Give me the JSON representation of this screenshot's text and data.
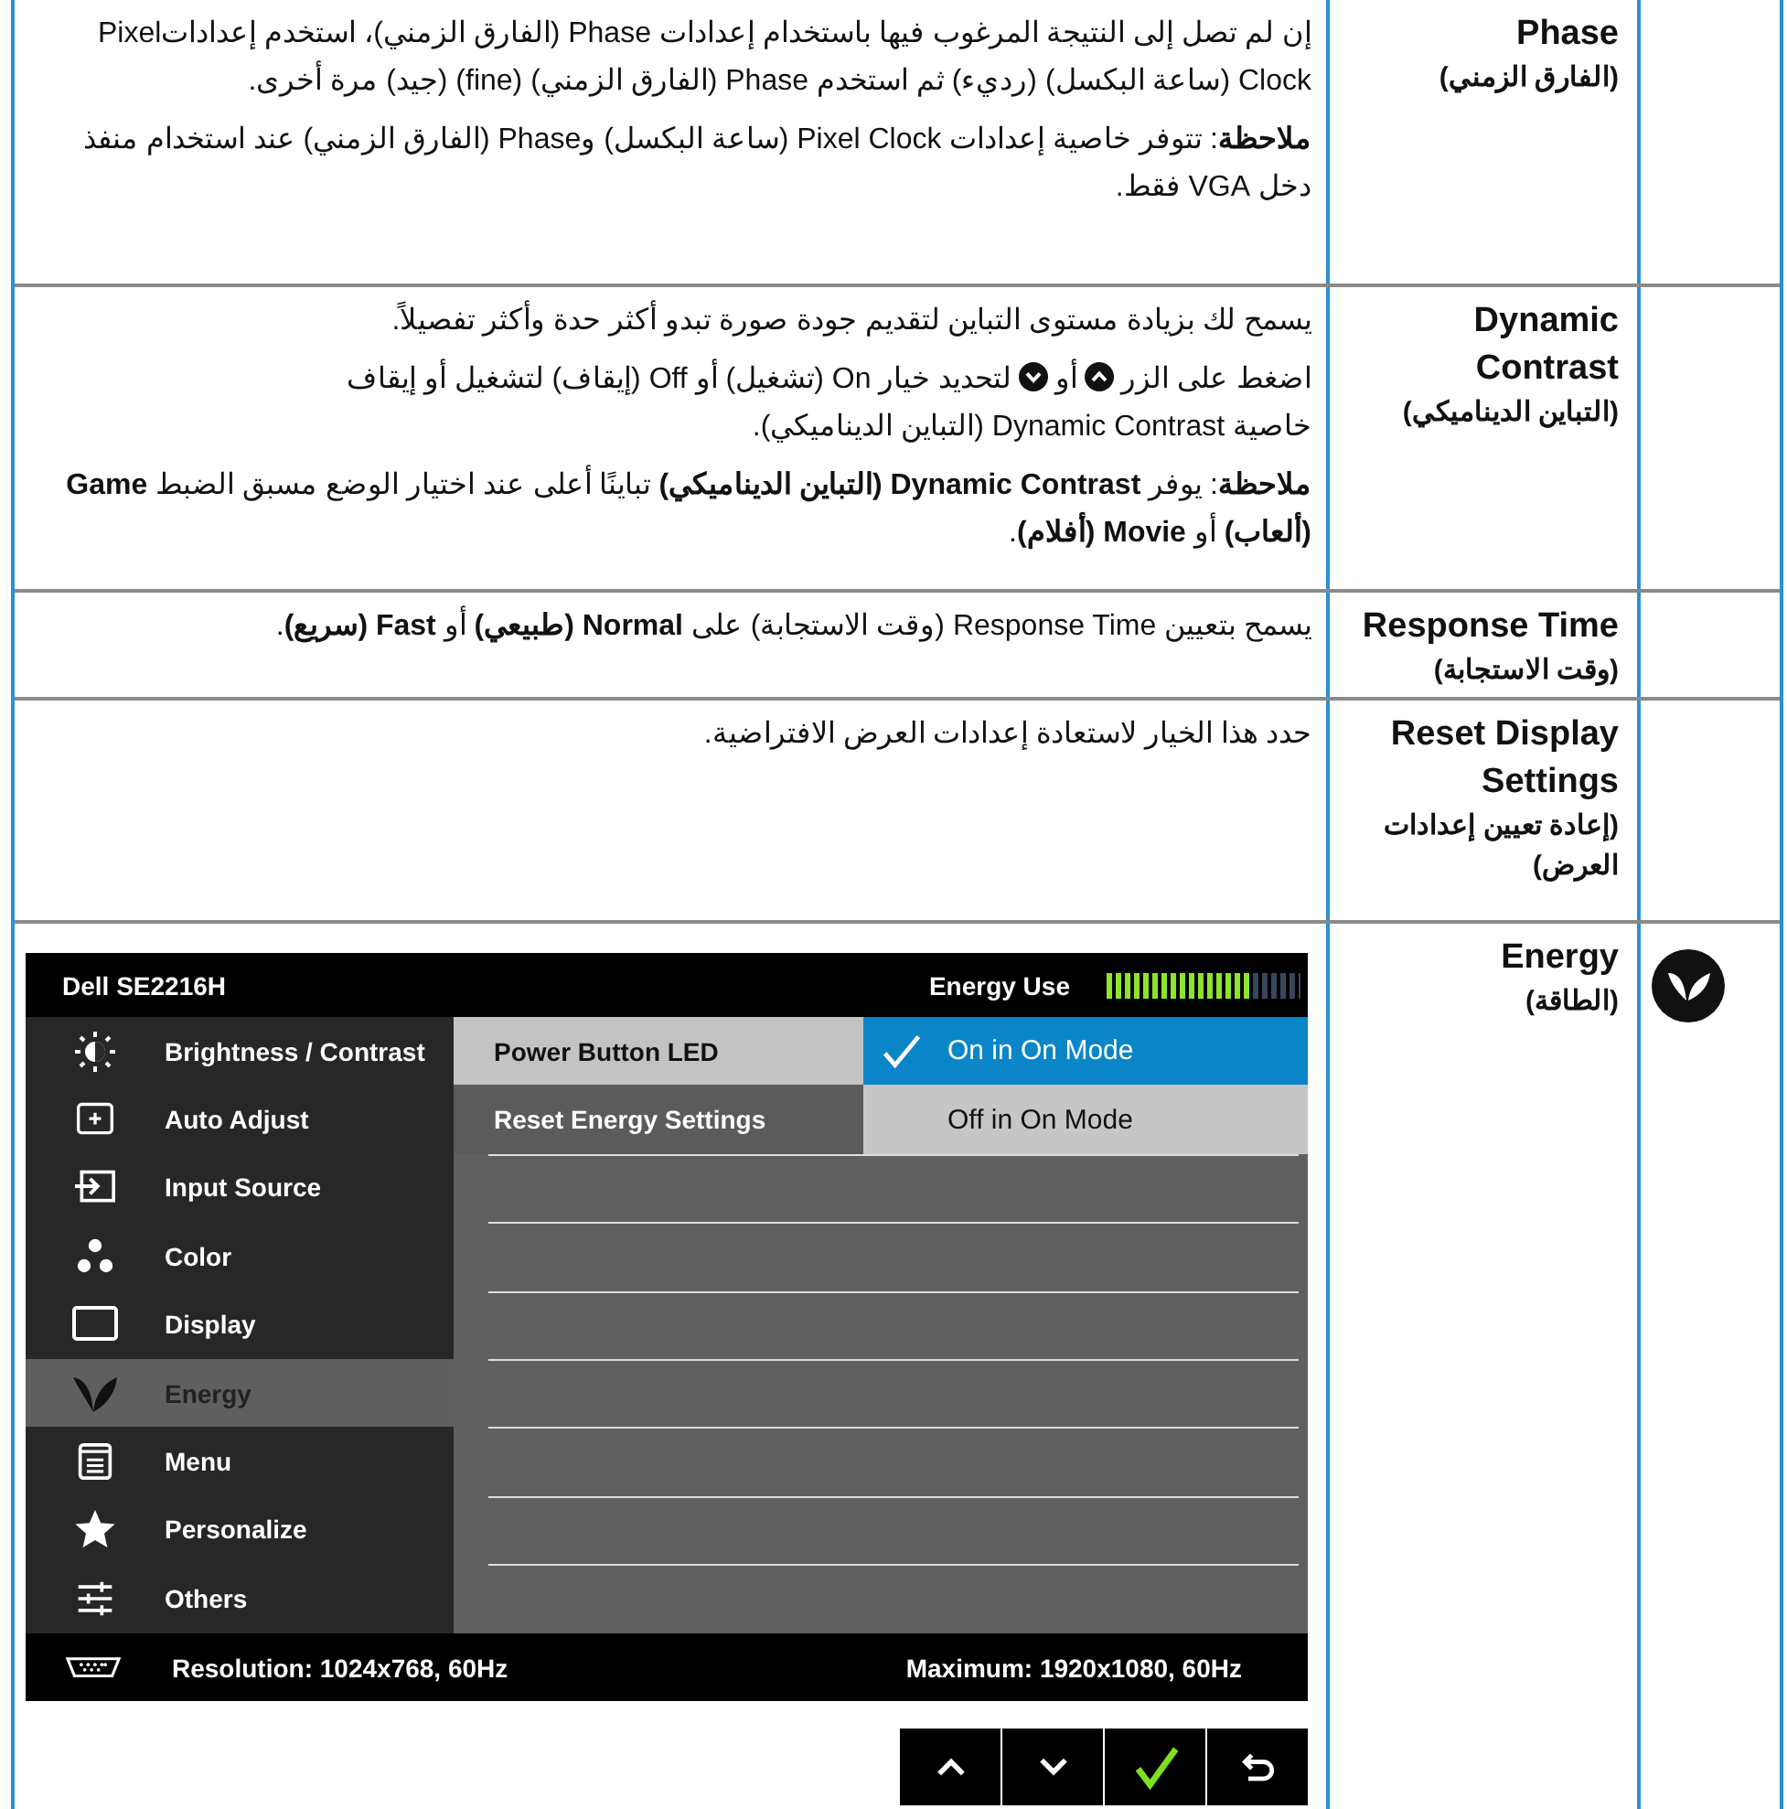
{
  "rows": [
    {
      "kind": "text",
      "name": "Phase",
      "name_ar": "(الفارق الزمني)",
      "paragraphs": [
        {
          "kind": "text",
          "text": "إن لم تصل إلى النتيجة المرغوب فيها باستخدام إعدادات Phase (الفارق الزمني)، استخدم إعداداتPixel Clock (ساعة البكسل) (رديء) ثم استخدم Phase (الفارق الزمني) (fine) (جيد) مرة أخرى."
        },
        {
          "kind": "text",
          "text": "**ملاحظة**: تتوفر خاصية إعدادات Pixel Clock (ساعة البكسل) وPhase (الفارق الزمني) عند استخدام منفذ دخل VGA فقط."
        }
      ]
    },
    {
      "kind": "text",
      "name": "Dynamic Contrast",
      "name_ar": "(التباين الديناميكي)",
      "paragraphs": [
        {
          "kind": "text",
          "text": "يسمح لك بزيادة مستوى التباين لتقديم جودة صورة تبدو أكثر حدة وأكثر تفصيلاً."
        },
        {
          "kind": "mixed",
          "lines": [
            [
              {
                "kind": "text",
                "text": "اضغط على الزر"
              },
              {
                "kind": "up"
              },
              {
                "kind": "text",
                "text": "أو"
              },
              {
                "kind": "down"
              },
              {
                "kind": "text",
                "text": "لتحديد خيار On (تشغيل) أو Off (إيقاف) لتشغيل أو إيقاف"
              }
            ],
            [
              {
                "kind": "text",
                "text": "خاصية Dynamic Contrast (التباين الديناميكي)."
              }
            ]
          ]
        },
        {
          "kind": "text",
          "text": "**ملاحظة**: يوفر **Dynamic Contrast (التباين الديناميكي)** تباينًا أعلى عند اختيار الوضع مسبق الضبط **Game (ألعاب)** أو **Movie (أفلام)**."
        }
      ]
    },
    {
      "kind": "text",
      "name": "Response Time",
      "name_ar": "(وقت الاستجابة)",
      "paragraphs": [
        {
          "kind": "text",
          "text": "يسمح بتعيين Response Time (وقت الاستجابة) على **Normal (طبيعي)** أو **Fast (سريع)**."
        }
      ]
    },
    {
      "kind": "text",
      "name": "Reset Display Settings",
      "name_ar": "(إعادة تعيين إعدادات العرض)",
      "paragraphs": [
        {
          "kind": "text",
          "text": "حدد هذا الخيار لاستعادة إعدادات العرض الافتراضية."
        }
      ]
    },
    {
      "kind": "osd",
      "name": "Energy",
      "name_ar": "(الطاقة)",
      "icon": true,
      "osd": {
        "title": "Dell SE2216H",
        "meter_label": "Energy Use",
        "level": 0.75,
        "menu": [
          {
            "label": "Brightness / Contrast",
            "selected": false
          },
          {
            "label": "Auto Adjust",
            "selected": false
          },
          {
            "label": "Input Source",
            "selected": false
          },
          {
            "label": "Color",
            "selected": false
          },
          {
            "label": "Display",
            "selected": false
          },
          {
            "label": "Energy",
            "selected": true
          },
          {
            "label": "Menu",
            "selected": false
          },
          {
            "label": "Personalize",
            "selected": false
          },
          {
            "label": "Others",
            "selected": false
          }
        ],
        "submenu": [
          {
            "label": "Power Button LED",
            "selected": true
          },
          {
            "label": "Reset Energy Settings",
            "selected": false
          }
        ],
        "options": [
          {
            "label": "On in On Mode",
            "checked": true
          },
          {
            "label": "Off in On Mode",
            "checked": false
          }
        ],
        "resolution": "Resolution: 1024x768, 60Hz",
        "maximum": "Maximum: 1920x1080, 60Hz",
        "buttons": [
          {
            "kind": "up"
          },
          {
            "kind": "down"
          },
          {
            "kind": "check"
          },
          {
            "kind": "back"
          }
        ]
      }
    }
  ]
}
